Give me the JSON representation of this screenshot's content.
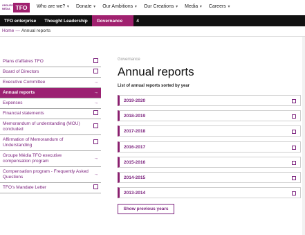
{
  "header": {
    "logo_small": "GROUPE MÉDIA",
    "logo_text": "TFO",
    "nav": [
      {
        "label": "Who are we?"
      },
      {
        "label": "Donate"
      },
      {
        "label": "Our Ambitions"
      },
      {
        "label": "Our Creations"
      },
      {
        "label": "Media"
      },
      {
        "label": "Careers"
      }
    ]
  },
  "subnav": {
    "tabs": [
      "TFO enterprise",
      "Thought Leadership",
      "Governance",
      "4"
    ]
  },
  "breadcrumb": {
    "home": "Home",
    "separator": "—",
    "current": "Annual reports"
  },
  "sidebar": {
    "items": [
      {
        "label": "Plans d'affaires TFO",
        "icon": "external-link-icon"
      },
      {
        "label": "Board of Directors",
        "icon": "external-link-icon"
      },
      {
        "label": "Executive Committee",
        "icon": "arrow-right-icon"
      },
      {
        "label": "Annual reports",
        "icon": "arrow-right-icon",
        "active": true
      },
      {
        "label": "Expenses",
        "icon": "arrow-right-icon"
      },
      {
        "label": "Financial statements",
        "icon": "external-link-icon"
      },
      {
        "label": "Memorandum of understanding (MOU) concluded",
        "icon": "external-link-icon"
      },
      {
        "label": "Affirmation of Memorandum of Understanding",
        "icon": "external-link-icon"
      },
      {
        "label": "Groupe Média TFO executive compensation program",
        "icon": "arrow-right-icon"
      },
      {
        "label": "Compensation program - Frequently Asked Questions",
        "icon": "arrow-right-icon"
      },
      {
        "label": "TFO's Mandate Letter",
        "icon": "external-link-icon"
      }
    ],
    "arrow_glyph": "→"
  },
  "main": {
    "eyebrow": "Governance",
    "title": "Annual reports",
    "subtitle": "List of annual reports sorted by year",
    "reports": [
      "2019-2020",
      "2018-2019",
      "2017-2018",
      "2016-2017",
      "2015-2016",
      "2014-2015",
      "2013-2014"
    ],
    "show_previous": "Show previous years"
  },
  "colors": {
    "brand": "#a0216f",
    "active_bg": "#9b2172",
    "link": "#7a1f7c",
    "bar": "#111111"
  }
}
